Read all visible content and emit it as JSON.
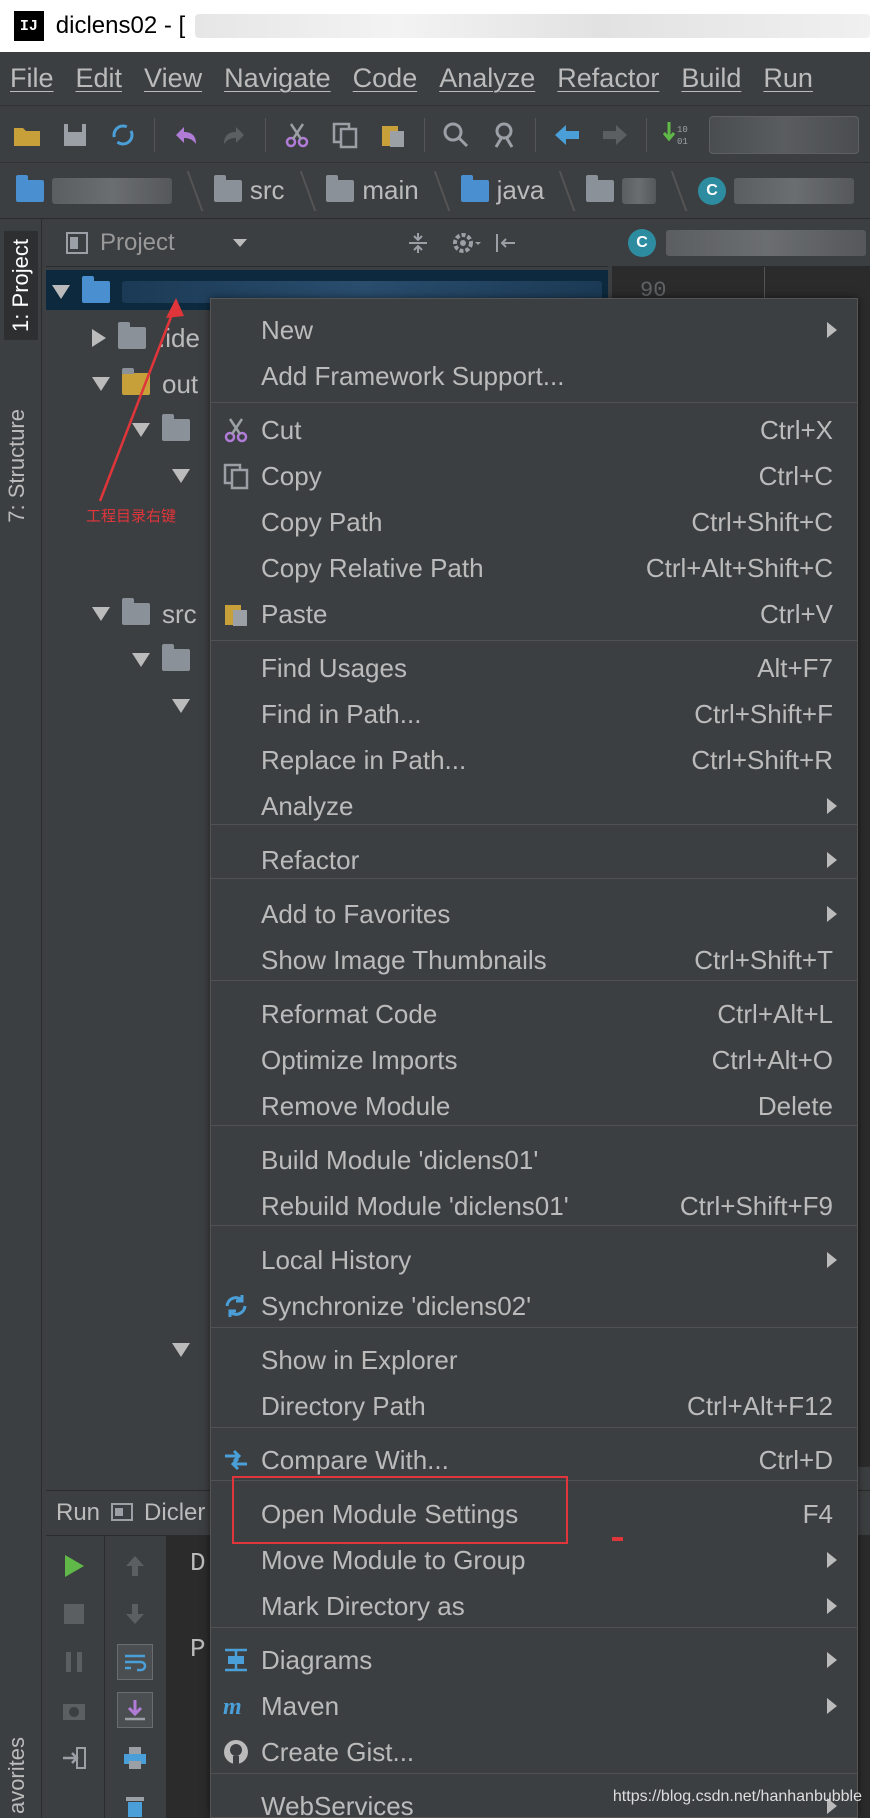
{
  "window": {
    "title": "diclens02 - ["
  },
  "menubar": {
    "items": [
      "File",
      "Edit",
      "View",
      "Navigate",
      "Code",
      "Analyze",
      "Refactor",
      "Build",
      "Run"
    ]
  },
  "breadcrumb": {
    "items": [
      "src",
      "main",
      "java"
    ]
  },
  "project_panel": {
    "title": "Project",
    "tree": [
      ".ide",
      "out",
      "src"
    ]
  },
  "left_strip": {
    "project_tab": "1: Project",
    "structure_tab": "7: Structure",
    "favorites_tab": "avorites"
  },
  "editor": {
    "line_number": "90"
  },
  "run_panel": {
    "label": "Run",
    "config": "Dicler",
    "console_chars": [
      "D",
      "P"
    ]
  },
  "context_menu": {
    "items": [
      {
        "label": "New",
        "shortcut": "",
        "submenu": true,
        "icon": ""
      },
      {
        "label": "Add Framework Support...",
        "shortcut": "",
        "submenu": false,
        "icon": ""
      },
      {
        "label": "Cut",
        "shortcut": "Ctrl+X",
        "submenu": false,
        "icon": "scissors-icon"
      },
      {
        "label": "Copy",
        "shortcut": "Ctrl+C",
        "submenu": false,
        "icon": "copy-icon"
      },
      {
        "label": "Copy Path",
        "shortcut": "Ctrl+Shift+C",
        "submenu": false,
        "icon": ""
      },
      {
        "label": "Copy Relative Path",
        "shortcut": "Ctrl+Alt+Shift+C",
        "submenu": false,
        "icon": ""
      },
      {
        "label": "Paste",
        "shortcut": "Ctrl+V",
        "submenu": false,
        "icon": "paste-icon"
      },
      {
        "label": "Find Usages",
        "shortcut": "Alt+F7",
        "submenu": false,
        "icon": ""
      },
      {
        "label": "Find in Path...",
        "shortcut": "Ctrl+Shift+F",
        "submenu": false,
        "icon": ""
      },
      {
        "label": "Replace in Path...",
        "shortcut": "Ctrl+Shift+R",
        "submenu": false,
        "icon": ""
      },
      {
        "label": "Analyze",
        "shortcut": "",
        "submenu": true,
        "icon": ""
      },
      {
        "label": "Refactor",
        "shortcut": "",
        "submenu": true,
        "icon": ""
      },
      {
        "label": "Add to Favorites",
        "shortcut": "",
        "submenu": true,
        "icon": ""
      },
      {
        "label": "Show Image Thumbnails",
        "shortcut": "Ctrl+Shift+T",
        "submenu": false,
        "icon": ""
      },
      {
        "label": "Reformat Code",
        "shortcut": "Ctrl+Alt+L",
        "submenu": false,
        "icon": ""
      },
      {
        "label": "Optimize Imports",
        "shortcut": "Ctrl+Alt+O",
        "submenu": false,
        "icon": ""
      },
      {
        "label": "Remove Module",
        "shortcut": "Delete",
        "submenu": false,
        "icon": ""
      },
      {
        "label": "Build Module 'diclens01'",
        "shortcut": "",
        "submenu": false,
        "icon": ""
      },
      {
        "label": "Rebuild Module 'diclens01'",
        "shortcut": "Ctrl+Shift+F9",
        "submenu": false,
        "icon": ""
      },
      {
        "label": "Local History",
        "shortcut": "",
        "submenu": true,
        "icon": ""
      },
      {
        "label": "Synchronize 'diclens02'",
        "shortcut": "",
        "submenu": false,
        "icon": "sync-icon"
      },
      {
        "label": "Show in Explorer",
        "shortcut": "",
        "submenu": false,
        "icon": ""
      },
      {
        "label": "Directory Path",
        "shortcut": "Ctrl+Alt+F12",
        "submenu": false,
        "icon": ""
      },
      {
        "label": "Compare With...",
        "shortcut": "Ctrl+D",
        "submenu": false,
        "icon": "compare-icon"
      },
      {
        "label": "Open Module Settings",
        "shortcut": "F4",
        "submenu": false,
        "icon": ""
      },
      {
        "label": "Move Module to Group",
        "shortcut": "",
        "submenu": true,
        "icon": ""
      },
      {
        "label": "Mark Directory as",
        "shortcut": "",
        "submenu": true,
        "icon": ""
      },
      {
        "label": "Diagrams",
        "shortcut": "",
        "submenu": true,
        "icon": "diagrams-icon"
      },
      {
        "label": "Maven",
        "shortcut": "",
        "submenu": true,
        "icon": "maven-icon"
      },
      {
        "label": "Create Gist...",
        "shortcut": "",
        "submenu": false,
        "icon": "github-icon"
      },
      {
        "label": "WebServices",
        "shortcut": "",
        "submenu": true,
        "icon": ""
      }
    ]
  },
  "annotation": {
    "text": "工程目录右键",
    "color": "#e0353a"
  },
  "watermark": "https://blog.csdn.net/hanhanbubble",
  "colors": {
    "background": "#3c3f41",
    "editor": "#2b2b2b",
    "selection": "#0d293e",
    "highlight": "#e0353a"
  }
}
